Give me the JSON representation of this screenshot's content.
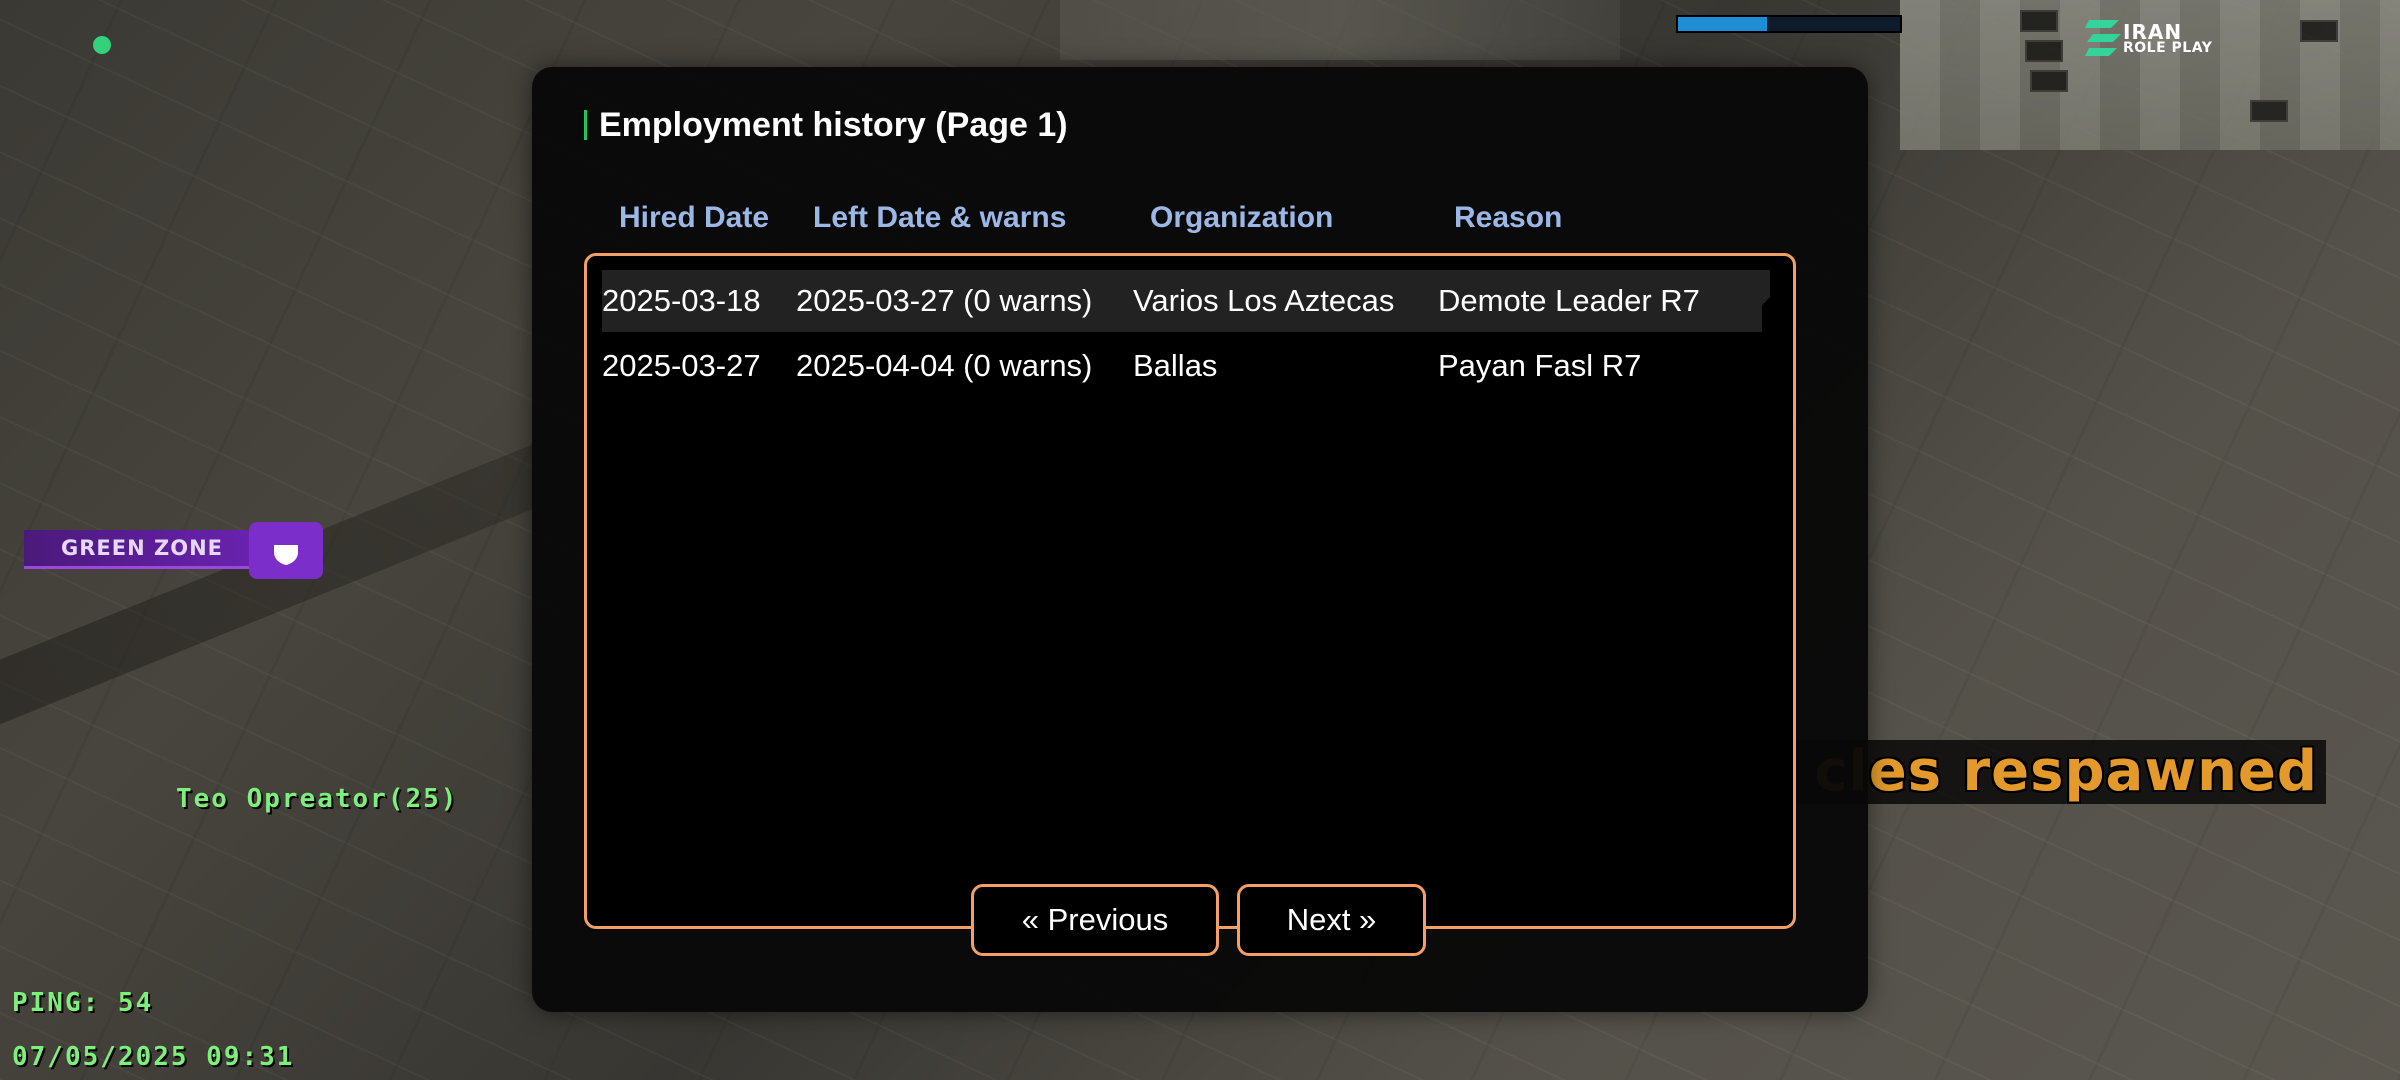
{
  "hud": {
    "logo": {
      "title": "IRAN",
      "subtitle": "ROLE PLAY"
    },
    "top_bar_progress": 0.4,
    "green_zone_label": "GREEN ZONE",
    "player_name": "Teo Opreator(25)",
    "announcement": "cles respawned",
    "ping": "PING: 54",
    "datetime": "07/05/2025 09:31"
  },
  "dialog": {
    "title": "Employment history (Page 1)",
    "columns": [
      "Hired Date",
      "Left Date & warns",
      "Organization",
      "Reason"
    ],
    "rows": [
      {
        "hired": "2025-03-18",
        "left": "2025-03-27 (0 warns)",
        "organization": "Varios Los Aztecas",
        "reason": "Demote Leader R7"
      },
      {
        "hired": "2025-03-27",
        "left": "2025-04-04 (0 warns)",
        "organization": "Ballas",
        "reason": "Payan Fasl R7"
      }
    ],
    "buttons": {
      "previous": "« Previous",
      "next": "Next »"
    }
  },
  "colors": {
    "accent_orange": "#f2a065",
    "header_blue": "#9bb7e6",
    "hud_green": "#7cf07a",
    "zone_purple": "#7b2ec9"
  }
}
